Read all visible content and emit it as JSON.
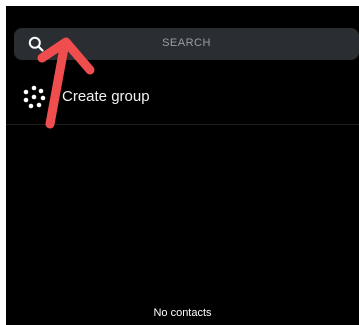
{
  "search": {
    "placeholder": "SEARCH",
    "icon": "search-icon"
  },
  "actions": {
    "create_group_label": "Create group",
    "create_group_icon": "group-dots-icon"
  },
  "contacts": {
    "empty_text": "No contacts"
  },
  "colors": {
    "background": "#000000",
    "search_bar": "#2a2d31",
    "annotation": "#f04e4e"
  }
}
